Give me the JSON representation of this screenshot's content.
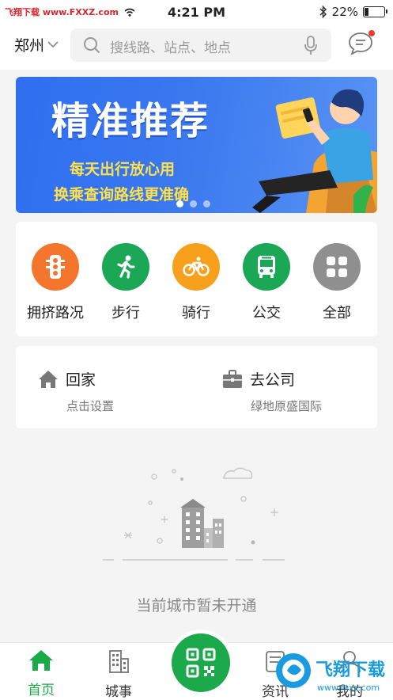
{
  "status_bar": {
    "carrier_watermark": "飞翔下载 www.FXXZ.com",
    "time": "4:21 PM",
    "battery": "22%"
  },
  "header": {
    "city": "郑州",
    "search_placeholder": "搜线路、站点、地点"
  },
  "banner": {
    "title": "精准推荐",
    "line1": "每天出行放心用",
    "line2": "换乘查询路线更准确",
    "slides": 3,
    "active_slide": 1
  },
  "quick_actions": [
    {
      "label": "拥挤路况",
      "color": "#f3762c",
      "icon": "traffic-light-icon"
    },
    {
      "label": "步行",
      "color": "#1aa756",
      "icon": "walking-icon"
    },
    {
      "label": "骑行",
      "color": "#f7a01b",
      "icon": "bicycle-icon"
    },
    {
      "label": "公交",
      "color": "#1aa756",
      "icon": "bus-icon"
    },
    {
      "label": "全部",
      "color": "#8f8f8f",
      "icon": "grid-icon"
    }
  ],
  "places": {
    "home": {
      "name": "回家",
      "sub": "点击设置"
    },
    "work": {
      "name": "去公司",
      "sub": "绿地原盛国际"
    }
  },
  "empty_state": {
    "text": "当前城市暂未开通"
  },
  "tabbar": {
    "home": "首页",
    "city": "城事",
    "news": "资讯",
    "trip": "我的",
    "watermark": "飞翔下载 www.fxxz.com"
  },
  "colors": {
    "accent": "#1aaa48",
    "banner_blue": "#3a78ef",
    "banner_yellow": "#ffe24a"
  }
}
